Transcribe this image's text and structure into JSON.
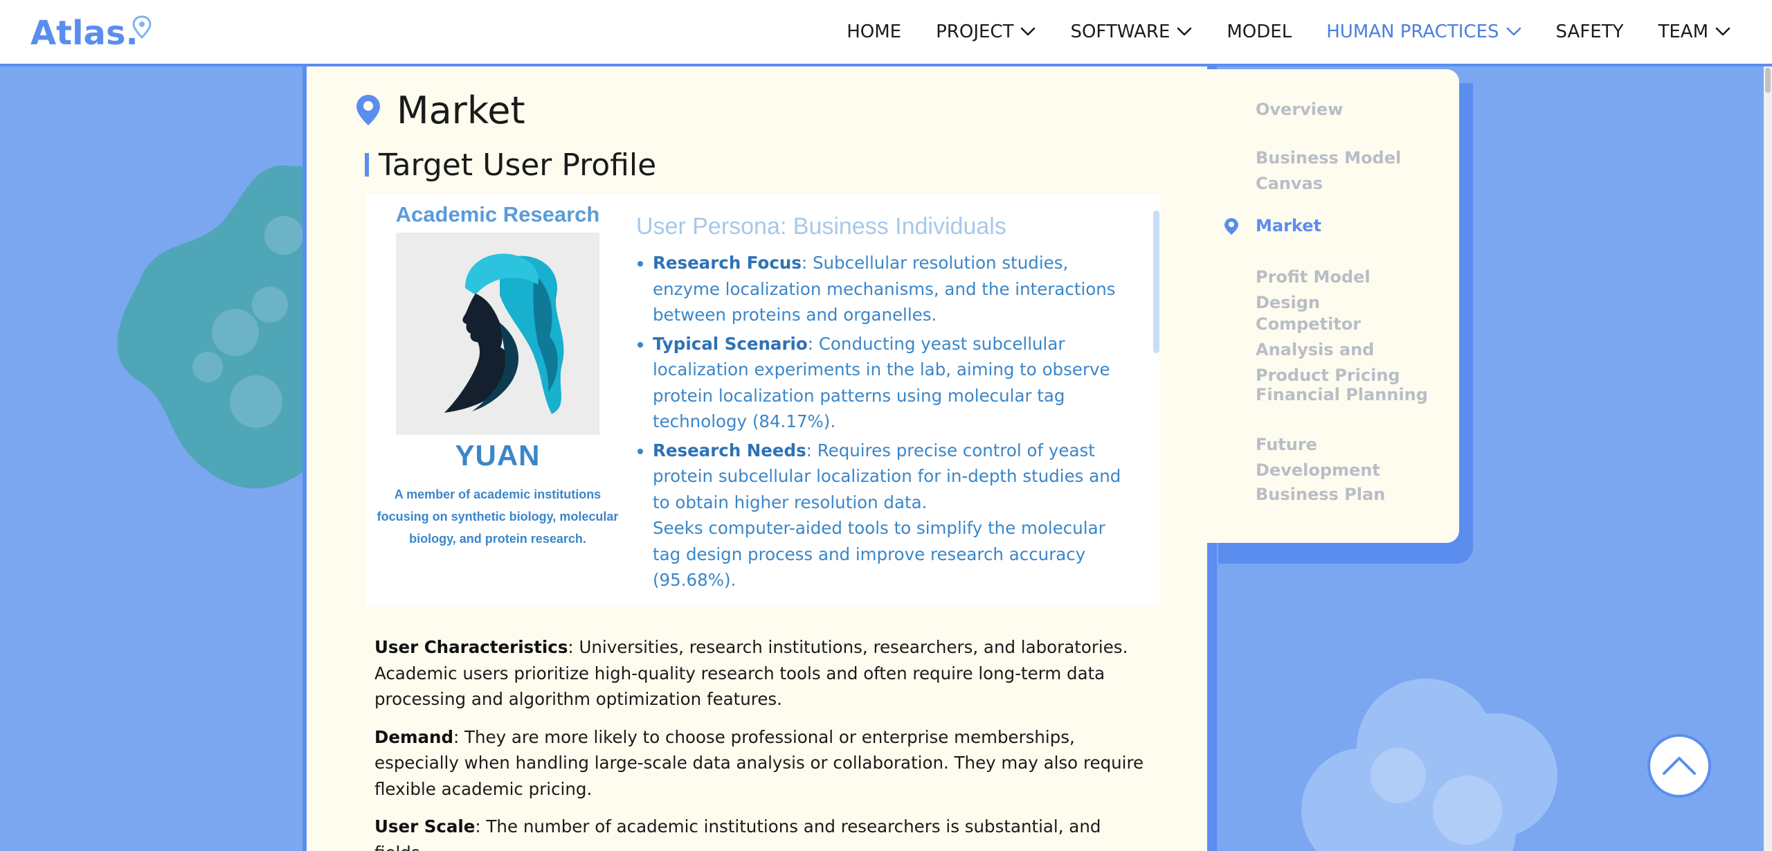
{
  "brand": {
    "name": "Atlas."
  },
  "nav": {
    "items": [
      {
        "label": "HOME",
        "dropdown": false,
        "active": false
      },
      {
        "label": "PROJECT",
        "dropdown": true,
        "active": false
      },
      {
        "label": "SOFTWARE",
        "dropdown": true,
        "active": false
      },
      {
        "label": "MODEL",
        "dropdown": false,
        "active": false
      },
      {
        "label": "HUMAN PRACTICES",
        "dropdown": true,
        "active": true
      },
      {
        "label": "SAFETY",
        "dropdown": false,
        "active": false
      },
      {
        "label": "TEAM",
        "dropdown": true,
        "active": false
      }
    ]
  },
  "main": {
    "title": "Market",
    "section_title": "Target User Profile",
    "persona_card": {
      "category": "Academic Research",
      "name": "YUAN",
      "description": "A member of academic institutions focusing on synthetic biology, molecular biology, and protein research.",
      "persona_title": "User Persona: Business Individuals",
      "items": [
        {
          "key": "Research Focus",
          "text": ": Subcellular resolution studies, enzyme localization mechanisms, and the interactions between proteins and organelles."
        },
        {
          "key": "Typical Scenario",
          "text": ": Conducting yeast subcellular localization experiments in the lab, aiming to observe protein localization patterns using molecular tag technology (84.17%)."
        },
        {
          "key": "Research Needs",
          "text": ": Requires precise control of yeast protein subcellular localization for in-depth studies and to obtain higher resolution data."
        }
      ],
      "extra_line": "Seeks computer-aided tools to simplify the molecular tag design process and improve research accuracy (95.68%)."
    },
    "paragraphs": [
      {
        "key": "User Characteristics",
        "text": ": Universities, research institutions, researchers, and laboratories. Academic users prioritize high-quality research tools and often require long-term data processing and algorithm optimization features."
      },
      {
        "key": "Demand",
        "text": ": They are more likely to choose professional or enterprise memberships, especially when handling large-scale data analysis or collaboration. They may also require flexible academic pricing."
      },
      {
        "key": "User Scale",
        "text": ": The number of academic institutions and researchers is substantial, and fields"
      }
    ]
  },
  "toc": {
    "items": [
      {
        "label": "Overview",
        "active": false
      },
      {
        "label": "Business Model Canvas",
        "active": false
      },
      {
        "label": "Market",
        "active": true
      },
      {
        "label": "Profit Model Design",
        "active": false
      },
      {
        "label": "Competitor Analysis and Product Pricing",
        "active": false
      },
      {
        "label": "Financial Planning",
        "active": false
      },
      {
        "label": "Future Development",
        "active": false
      },
      {
        "label": "Business Plan",
        "active": false
      }
    ]
  },
  "icons": {
    "logo_pin": "location-pin-icon",
    "title_pin": "location-pin-icon",
    "toc_pin": "location-pin-icon",
    "nav_dropdown": "chevron-down-icon",
    "back_to_top": "chevron-up-icon"
  },
  "colors": {
    "accent": "#5b8def",
    "background": "#7ba7f0",
    "panel": "#fdfcef",
    "persona_text": "#3a86c8",
    "toc_inactive": "#b9bdc6"
  }
}
